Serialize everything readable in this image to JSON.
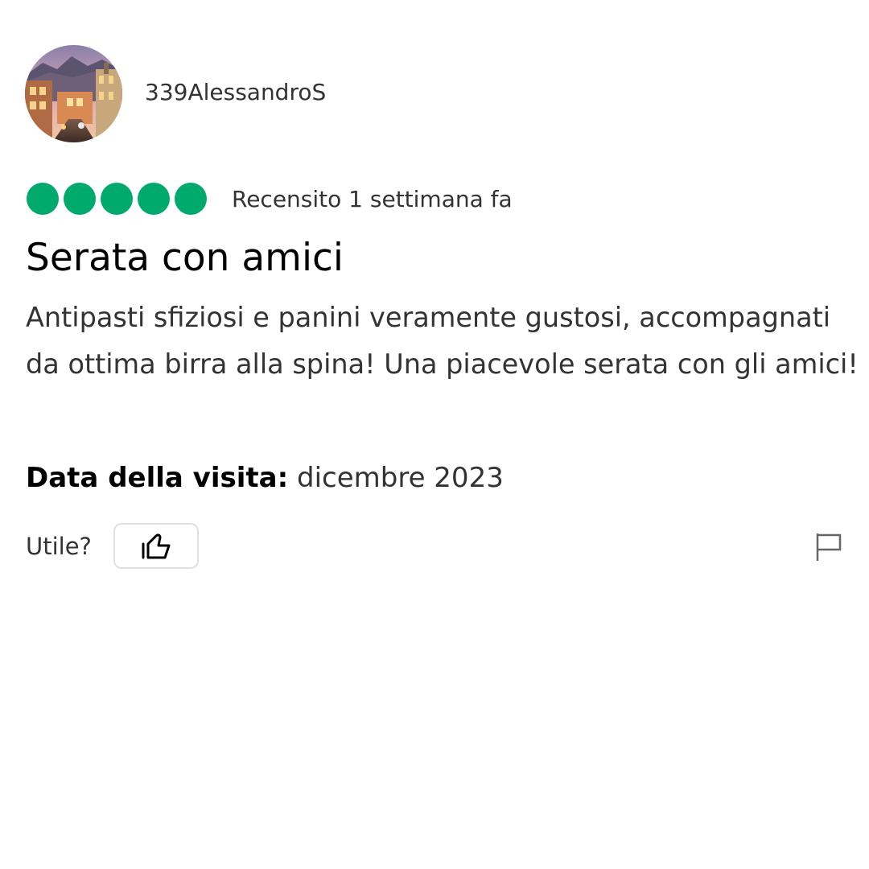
{
  "review": {
    "username": "339AlessandroS",
    "avatar_icon": "profile-photo-town-street",
    "rating": {
      "value": 5,
      "max": 5,
      "color": "#00aa6c"
    },
    "reviewed_label": "Recensito 1 settimana fa",
    "title": "Serata con amici",
    "body": "Antipasti sfiziosi e panini veramente gustosi, accompagnati da ottima birra alla spina! Una piacevole serata con gli amici!",
    "visit_date_label": "Data della visita:",
    "visit_date_value": "dicembre 2023",
    "helpful_label": "Utile?",
    "helpful_icon": "thumbs-up-icon",
    "report_icon": "flag-icon"
  }
}
